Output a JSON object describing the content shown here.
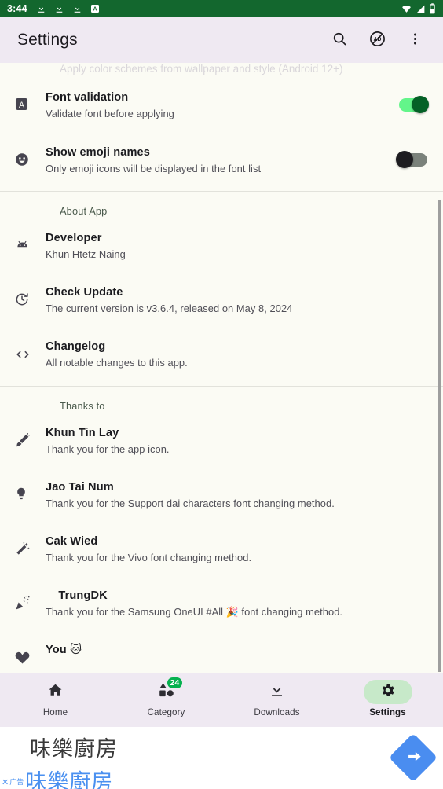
{
  "status_bar": {
    "time": "3:44",
    "left_icons": [
      "download-icon",
      "download-icon",
      "download-icon",
      "app-badge-a-icon"
    ],
    "right_icons": [
      "wifi-icon",
      "cell-signal-icon",
      "battery-icon"
    ],
    "background_color": "#13672e"
  },
  "toolbar": {
    "title": "Settings",
    "actions": [
      {
        "name": "search-icon",
        "label": "Search"
      },
      {
        "name": "remove-ads-icon",
        "label": "AD"
      },
      {
        "name": "overflow-menu-icon",
        "label": "More options"
      }
    ],
    "background_color": "#efe9f2"
  },
  "content": {
    "partial_top_text": "Apply color schemes from wallpaper and style (Android 12+)",
    "settings_items": [
      {
        "icon": "font-a-icon",
        "title": "Font validation",
        "subtitle": "Validate font before applying",
        "toggle": "on"
      },
      {
        "icon": "emoji-smiley-icon",
        "title": "Show emoji names",
        "subtitle": "Only emoji icons will be displayed in the font list",
        "toggle": "off"
      }
    ],
    "sections": [
      {
        "header": "About App",
        "items": [
          {
            "icon": "android-robot-icon",
            "title": "Developer",
            "subtitle": "Khun Htetz Naing"
          },
          {
            "icon": "update-clock-icon",
            "title": "Check Update",
            "subtitle": "The current version is v3.6.4, released on May 8, 2024"
          },
          {
            "icon": "code-brackets-icon",
            "title": "Changelog",
            "subtitle": "All notable changes to this app."
          }
        ]
      },
      {
        "header": "Thanks to",
        "items": [
          {
            "icon": "paint-brush-icon",
            "title": "Khun Tin Lay",
            "subtitle": "Thank you for the app icon."
          },
          {
            "icon": "lightbulb-icon",
            "title": "Jao Tai Num",
            "subtitle": "Thank you for the Support dai characters font changing method."
          },
          {
            "icon": "magic-wand-icon",
            "title": "Cak Wied",
            "subtitle": "Thank you for the Vivo font changing method."
          },
          {
            "icon": "party-popper-icon",
            "title": "__TrungDK__",
            "subtitle": "Thank you for the Samsung OneUI #All 🎉 font changing method."
          },
          {
            "icon": "heart-icon",
            "title": "You 🐱",
            "subtitle": ""
          }
        ]
      }
    ]
  },
  "bottom_nav": {
    "items": [
      {
        "icon": "home-icon",
        "label": "Home",
        "active": false,
        "badge": ""
      },
      {
        "icon": "category-shapes-icon",
        "label": "Category",
        "active": false,
        "badge": "24"
      },
      {
        "icon": "download-icon",
        "label": "Downloads",
        "active": false,
        "badge": ""
      },
      {
        "icon": "gear-icon",
        "label": "Settings",
        "active": true,
        "badge": ""
      }
    ],
    "active_pill_color": "#c7e9c9",
    "badge_color": "#05b14f"
  },
  "ad_banner": {
    "title": "味樂廚房",
    "subtitle": "味樂廚房",
    "close_label": "✕",
    "ad_tag": "广告",
    "cta_icon": "arrow-forward-icon",
    "accent_color": "#4a8df0"
  }
}
